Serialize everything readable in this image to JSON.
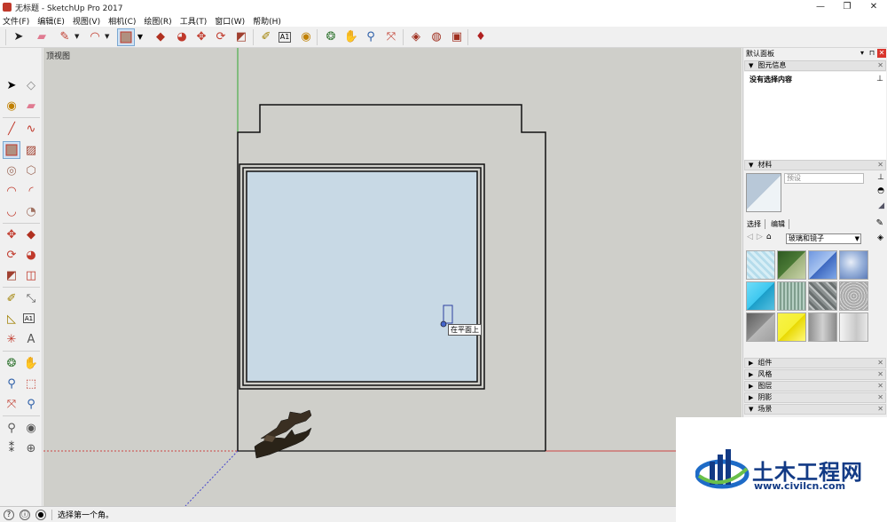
{
  "window": {
    "title": "无标题 - SketchUp Pro 2017",
    "minimize": "—",
    "maximize": "❐",
    "close": "✕"
  },
  "menu": [
    "文件(F)",
    "编辑(E)",
    "视图(V)",
    "相机(C)",
    "绘图(R)",
    "工具(T)",
    "窗口(W)",
    "帮助(H)"
  ],
  "viewport": {
    "label": "顶视图",
    "tooltip": "在平面上",
    "colors": {
      "background": "#cfcfca",
      "glass": "#c8d9e5",
      "red_axis": "#c44",
      "green_axis": "#3a3",
      "blue_axis": "#44c"
    }
  },
  "tray": {
    "title": "默认面板",
    "entity_info": {
      "header": "图元信息",
      "body": "没有选择内容"
    },
    "materials": {
      "header": "材料",
      "name_placeholder": "预设",
      "tab_select": "选择",
      "tab_edit": "编辑",
      "collection": "玻璃和镜子",
      "swatches": [
        "#bfe0ee",
        "#3d6a2e",
        "#7fa8e8",
        "#8aa8d6",
        "#3ec8f0",
        "#b7d0c4",
        "#9aa0a0",
        "#c8c8c8",
        "#7f7f7f",
        "#f5f033",
        "#b0b0b0",
        "#e2e2e2"
      ]
    },
    "sections": [
      "组件",
      "风格",
      "图层",
      "阴影",
      "场景"
    ]
  },
  "status": {
    "message": "选择第一个角。"
  },
  "watermark": {
    "name": "土木工程网",
    "url": "www.civilcn.com"
  }
}
